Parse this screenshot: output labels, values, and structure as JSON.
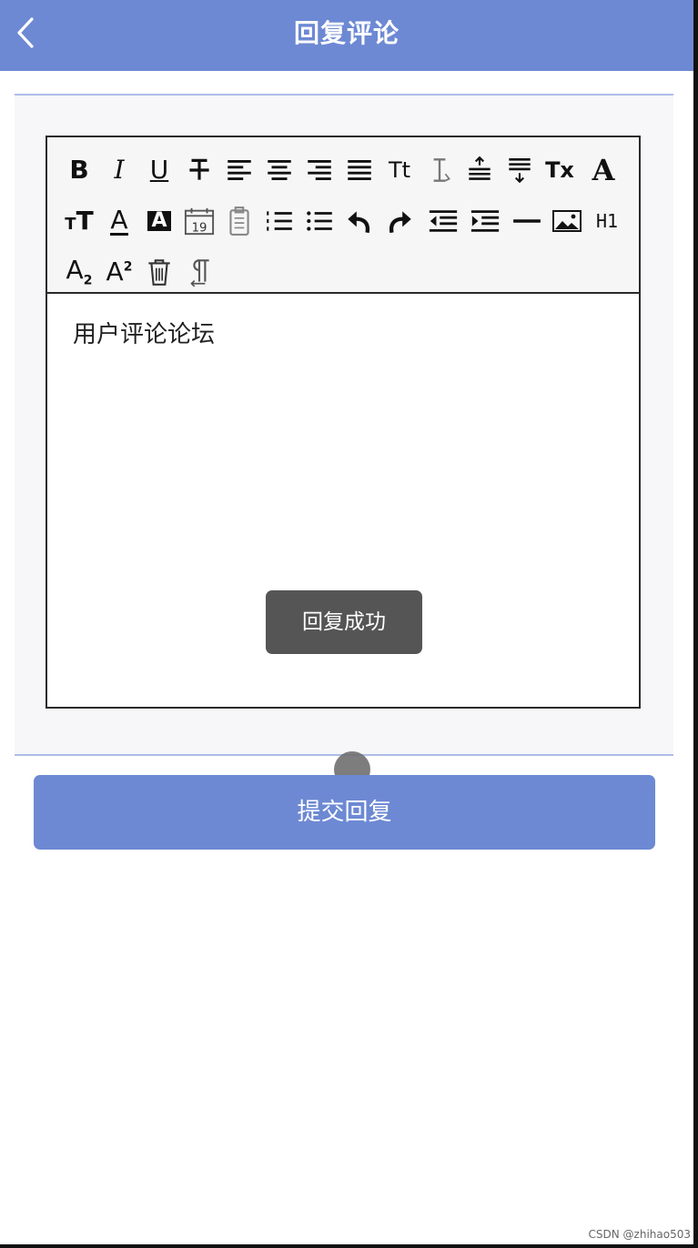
{
  "header": {
    "title": "回复评论"
  },
  "editor": {
    "toolbar": {
      "labels": {
        "bold": "B",
        "italic": "I",
        "underline": "U",
        "font_size_tt": "Tt",
        "clear_format": "Tx",
        "font_a": "A",
        "text_size": "T",
        "font_color": "A",
        "bg_color": "A",
        "date": "19",
        "heading": "H1",
        "subscript": "A",
        "subscript_mark": "2",
        "superscript": "A",
        "superscript_mark": "2"
      }
    },
    "content": "用户评论论坛"
  },
  "toast": {
    "message": "回复成功"
  },
  "submit": {
    "label": "提交回复"
  },
  "watermark": "CSDN @zhihao503"
}
